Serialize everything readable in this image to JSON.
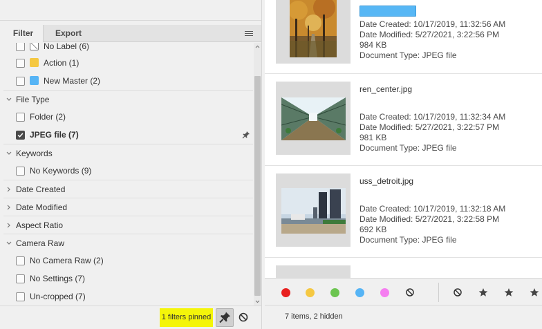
{
  "filter_panel": {
    "tabs": [
      {
        "label": "Filter"
      },
      {
        "label": "Export"
      }
    ],
    "sections": {
      "labels": {
        "items": [
          {
            "label": "No Label (6)"
          },
          {
            "label": "Action (1)",
            "color": "#f5c842"
          },
          {
            "label": "New Master (2)",
            "color": "#56b4f5"
          }
        ]
      },
      "file_type": {
        "title": "File Type",
        "items": [
          {
            "label": "Folder (2)",
            "checked": false
          },
          {
            "label": "JPEG file (7)",
            "checked": true
          }
        ]
      },
      "keywords": {
        "title": "Keywords",
        "items": [
          {
            "label": "No Keywords (9)"
          }
        ]
      },
      "date_created": {
        "title": "Date Created"
      },
      "date_modified": {
        "title": "Date Modified"
      },
      "aspect_ratio": {
        "title": "Aspect Ratio"
      },
      "camera_raw": {
        "title": "Camera Raw",
        "items": [
          {
            "label": "No Camera Raw (2)"
          },
          {
            "label": "No Settings (7)"
          },
          {
            "label": "Un-cropped (7)"
          }
        ]
      }
    },
    "footer": {
      "pinned_text": "1 filters pinned",
      "highlight_color": "#f4f50a"
    }
  },
  "content": {
    "files": [
      {
        "name": "",
        "label_color": "#57b7f5",
        "date_created": "Date Created: 10/17/2019, 11:32:56 AM",
        "date_modified": "Date Modified: 5/27/2021, 3:22:56 PM",
        "size": "984 KB",
        "doc_type": "Document Type: JPEG file"
      },
      {
        "name": "ren_center.jpg",
        "date_created": "Date Created: 10/17/2019, 11:32:34 AM",
        "date_modified": "Date Modified: 5/27/2021, 3:22:57 PM",
        "size": "981 KB",
        "doc_type": "Document Type: JPEG file"
      },
      {
        "name": "uss_detroit.jpg",
        "date_created": "Date Created: 10/17/2019, 11:32:18 AM",
        "date_modified": "Date Modified: 5/27/2021, 3:22:58 PM",
        "size": "692 KB",
        "doc_type": "Document Type: JPEG file"
      }
    ],
    "label_colors": [
      "#e8201f",
      "#f5c842",
      "#6cc550",
      "#56b4f5",
      "#f57ef0"
    ],
    "status": "7 items, 2 hidden"
  }
}
